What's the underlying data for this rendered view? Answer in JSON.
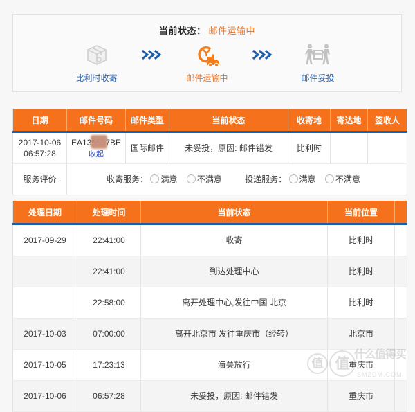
{
  "status_panel": {
    "label": "当前状态：",
    "value": "邮件运输中",
    "steps": [
      {
        "icon": "package-box-icon",
        "label": "比利时收寄",
        "active": false
      },
      {
        "icon": "truck-clock-icon",
        "label": "邮件运输中",
        "active": true
      },
      {
        "icon": "delivery-people-icon",
        "label": "邮件妥投",
        "active": false
      }
    ],
    "arrow_icon": "chevrons-right-icon",
    "colors": {
      "accent": "#ec7422",
      "link": "#2b62ad",
      "arrow": "#1f5fa9"
    }
  },
  "summary_table": {
    "headers": [
      "日期",
      "邮件号码",
      "邮件类型",
      "当前状态",
      "收寄地",
      "寄达地",
      "签收人"
    ],
    "row": {
      "date": "2017-10-06 06:57:28",
      "mail_no": "EA1355",
      "mail_no_suffix": "57BE",
      "collapse_link": "收起",
      "mail_type": "国际邮件",
      "status": "未妥投，原因: 邮件错发",
      "origin": "比利时",
      "destination": "",
      "signer": ""
    },
    "rating_row": {
      "title": "服务评价",
      "groups": [
        {
          "label": "收寄服务：",
          "options": [
            "满意",
            "不满意"
          ]
        },
        {
          "label": "投递服务：",
          "options": [
            "满意",
            "不满意"
          ]
        }
      ]
    }
  },
  "trace_table": {
    "headers": [
      "处理日期",
      "处理时间",
      "当前状态",
      "当前位置",
      ""
    ],
    "rows": [
      {
        "date": "2017-09-29",
        "time": "22:41:00",
        "status": "收寄",
        "location": "比利时",
        "extra": ""
      },
      {
        "date": "",
        "time": "22:41:00",
        "status": "到达处理中心",
        "location": "比利时",
        "extra": ""
      },
      {
        "date": "",
        "time": "22:58:00",
        "status": "离开处理中心,发往中国 北京",
        "location": "比利时",
        "extra": ""
      },
      {
        "date": "2017-10-03",
        "time": "07:00:00",
        "status": "离开北京市 发往重庆市（经转）",
        "location": "北京市",
        "extra": ""
      },
      {
        "date": "2017-10-05",
        "time": "17:23:13",
        "status": "海关放行",
        "location": "重庆市",
        "extra": ""
      },
      {
        "date": "2017-10-06",
        "time": "06:57:28",
        "status": "未妥投，原因: 邮件错发",
        "location": "重庆市",
        "extra": ""
      }
    ]
  },
  "watermark": {
    "coin1": "值",
    "coin2": "值",
    "text": "什么值得买",
    "sub": "SMZDM.COM"
  }
}
